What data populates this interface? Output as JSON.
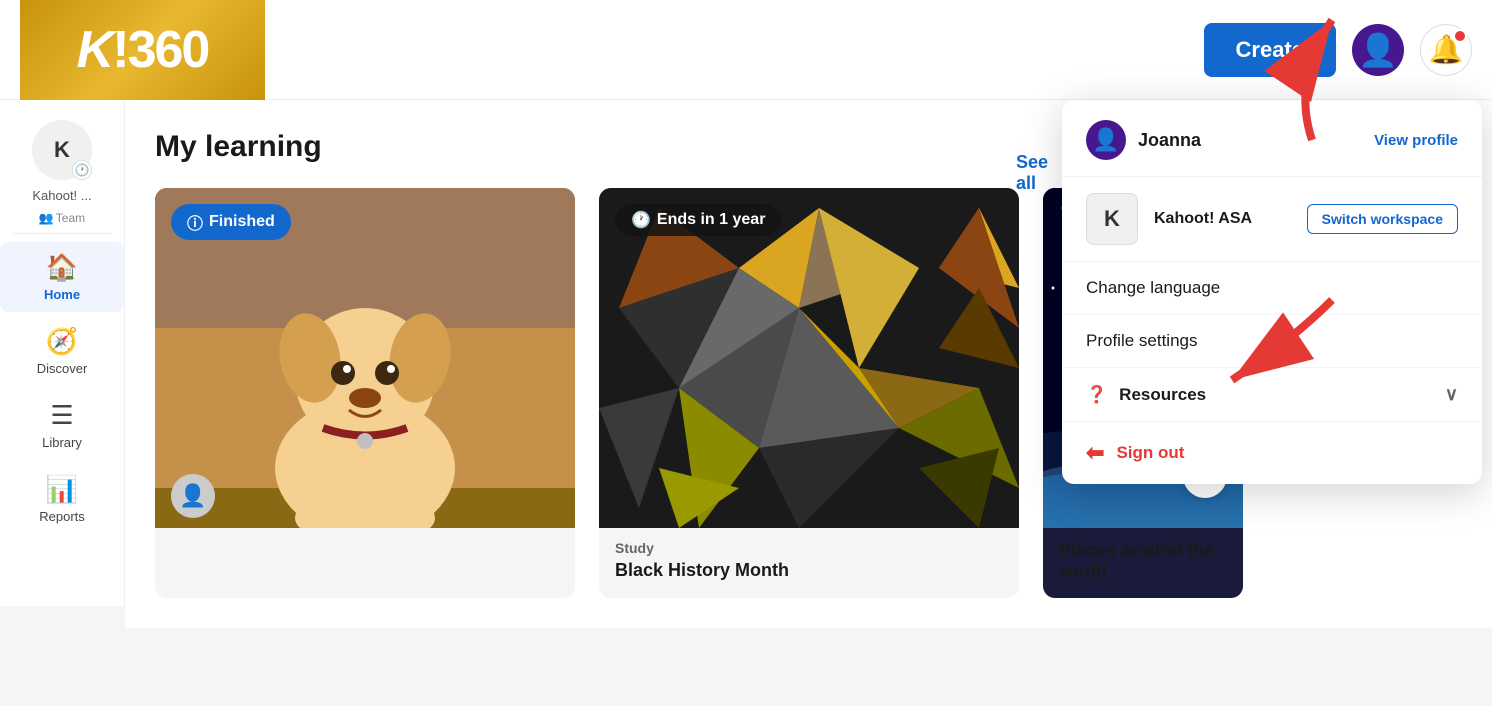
{
  "logo": {
    "text": "K!360"
  },
  "header": {
    "create_label": "Create",
    "see_all_label": "See all"
  },
  "sidebar": {
    "workspace_initial": "K",
    "workspace_name": "Kahoot! ...",
    "workspace_team": "Team",
    "items": [
      {
        "label": "Home",
        "icon": "🏠",
        "active": true
      },
      {
        "label": "Discover",
        "icon": "🧭",
        "active": false
      },
      {
        "label": "Library",
        "icon": "☰",
        "active": false
      },
      {
        "label": "Reports",
        "icon": "📊",
        "active": false
      }
    ]
  },
  "main": {
    "page_title": "My learning",
    "cards": [
      {
        "badge": "Finished",
        "badge_style": "blue",
        "category": "",
        "name": "",
        "type": "puppy"
      },
      {
        "badge": "Ends in 1 year",
        "badge_style": "dark",
        "category": "Study",
        "name": "Black History Month",
        "type": "origami"
      },
      {
        "badge": "",
        "badge_style": "",
        "category": "",
        "name": "Places around the world",
        "type": "space"
      }
    ]
  },
  "dropdown": {
    "username": "Joanna",
    "view_profile_label": "View profile",
    "workspace_initial": "K",
    "workspace_name": "Kahoot! ASA",
    "switch_workspace_label": "Switch workspace",
    "change_language_label": "Change language",
    "profile_settings_label": "Profile settings",
    "resources_label": "Resources",
    "sign_out_label": "Sign out"
  }
}
